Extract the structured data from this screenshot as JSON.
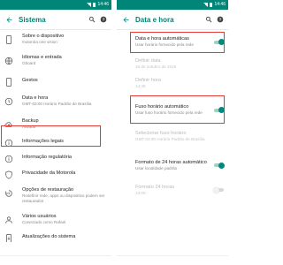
{
  "left": {
    "status_time": "14:46",
    "title": "Sistema",
    "items": [
      {
        "title": "Sobre o dispositivo",
        "subtitle": "motorola one vision"
      },
      {
        "title": "Idiomas e entrada",
        "subtitle": "Gboard"
      },
      {
        "title": "Gestos",
        "subtitle": ""
      },
      {
        "title": "Data e hora",
        "subtitle": "GMT-03:00 Horário Padrão de Brasília"
      },
      {
        "title": "Backup",
        "subtitle": "Ativado"
      },
      {
        "title": "Informações legais",
        "subtitle": ""
      },
      {
        "title": "Informação regulatória",
        "subtitle": ""
      },
      {
        "title": "Privacidade da Motorola",
        "subtitle": ""
      },
      {
        "title": "Opções de restauração",
        "subtitle": "Redefinir rede, apps ou dispositivo podem ser restaurados"
      },
      {
        "title": "Vários usuários",
        "subtitle": "Conectado como Rafael"
      },
      {
        "title": "Atualizações do sistema",
        "subtitle": ""
      }
    ]
  },
  "right": {
    "status_time": "14:46",
    "title": "Data e hora",
    "items": [
      {
        "title": "Data e hora automáticas",
        "subtitle": "Usar horário fornecido pela rede",
        "toggle": true
      },
      {
        "title": "Definir data",
        "subtitle": "16 de outubro de 2019",
        "disabled": true
      },
      {
        "title": "Definir hora",
        "subtitle": "14:46",
        "disabled": true
      },
      {
        "title": "Fuso horário automático",
        "subtitle": "Usar fuso horário fornecido pela rede",
        "toggle": true
      },
      {
        "title": "Selecionar fuso horário",
        "subtitle": "GMT-03:00 Horário Padrão de Brasília",
        "disabled": true
      },
      {
        "title": "Formato de 24 horas automático",
        "subtitle": "Usar localidade padrão",
        "toggle": true
      },
      {
        "title": "Formato 24 horas",
        "subtitle": "13:00",
        "disabled": true,
        "toggle": false
      }
    ]
  },
  "colors": {
    "accent": "#008577",
    "toggle_on": "#00897b",
    "highlight": "#e53935"
  },
  "icons": {
    "back": "arrow-left-icon",
    "search": "search-icon",
    "help": "help-icon",
    "left_items": [
      "phone-icon",
      "globe-icon",
      "phone-icon",
      "clock-icon",
      "cloud-upload-icon",
      "info-icon",
      "info-icon",
      "shield-icon",
      "history-icon",
      "person-icon",
      "system-update-icon"
    ]
  }
}
